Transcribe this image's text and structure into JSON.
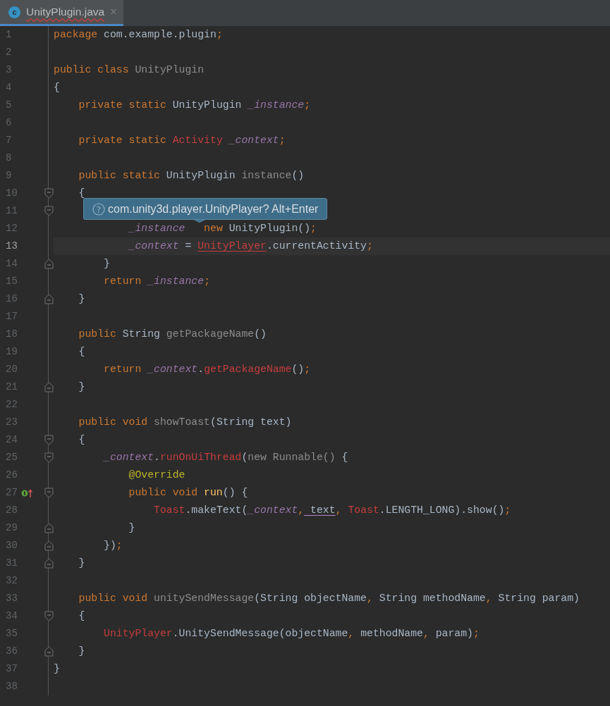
{
  "tab": {
    "icon_text": "c",
    "title": "UnityPlugin.java",
    "close": "×",
    "selected": true,
    "error": true
  },
  "tooltip": {
    "icon_text": "?",
    "text": "com.unity3d.player.UnityPlayer? Alt+Enter"
  },
  "lines": [
    {
      "number": "1",
      "current": false,
      "tokens": [
        {
          "text": "package",
          "kind": "kw"
        },
        {
          "text": " com.example.plugin",
          "kind": "plain"
        },
        {
          "text": ";",
          "kind": "kw"
        }
      ]
    },
    {
      "number": "2",
      "current": false
    },
    {
      "number": "3",
      "current": false,
      "tokens": [
        {
          "text": "public class",
          "kind": "kw"
        },
        {
          "text": " UnityPlugin",
          "kind": "unused"
        }
      ]
    },
    {
      "number": "4",
      "current": false,
      "tokens": [
        {
          "text": "{",
          "kind": "plain"
        }
      ]
    },
    {
      "number": "5",
      "current": false,
      "tokens": [
        {
          "text": "    private static",
          "kind": "kw"
        },
        {
          "text": " UnityPlugin ",
          "kind": "plain"
        },
        {
          "text": "_instance",
          "kind": "field"
        },
        {
          "text": ";",
          "kind": "kw"
        }
      ]
    },
    {
      "number": "6",
      "current": false
    },
    {
      "number": "7",
      "current": false,
      "tokens": [
        {
          "text": "    private static",
          "kind": "kw"
        },
        {
          "text": " Activity",
          "kind": "error"
        },
        {
          "text": " _context",
          "kind": "field"
        },
        {
          "text": ";",
          "kind": "kw"
        }
      ]
    },
    {
      "number": "8",
      "current": false
    },
    {
      "number": "9",
      "current": false,
      "tokens": [
        {
          "text": "    public static",
          "kind": "kw"
        },
        {
          "text": " UnityPlugin ",
          "kind": "plain"
        },
        {
          "text": "instance",
          "kind": "unused"
        },
        {
          "text": "()",
          "kind": "plain"
        }
      ]
    },
    {
      "number": "10",
      "current": false,
      "fold_start": true,
      "tokens": [
        {
          "text": "    {",
          "kind": "plain"
        }
      ]
    },
    {
      "number": "11",
      "current": false,
      "fold_start": true
    },
    {
      "number": "12",
      "current": false,
      "tokens": [
        {
          "text": "            _instance",
          "kind": "field"
        },
        {
          "text": "   new",
          "kind": "kw"
        },
        {
          "text": " UnityPlugin()",
          "kind": "plain"
        },
        {
          "text": ";",
          "kind": "kw"
        }
      ]
    },
    {
      "number": "13",
      "current": true,
      "tokens": [
        {
          "text": "            _context",
          "kind": "field"
        },
        {
          "text": " = ",
          "kind": "plain"
        },
        {
          "text": "UnityPlayer",
          "kind": "unresolved"
        },
        {
          "text": ".currentActivity",
          "kind": "plain"
        },
        {
          "text": ";",
          "kind": "kw"
        }
      ]
    },
    {
      "number": "14",
      "current": false,
      "fold_end": true,
      "tokens": [
        {
          "text": "        }",
          "kind": "plain"
        }
      ]
    },
    {
      "number": "15",
      "current": false,
      "tokens": [
        {
          "text": "        return",
          "kind": "kw"
        },
        {
          "text": " _instance",
          "kind": "field"
        },
        {
          "text": ";",
          "kind": "kw"
        }
      ]
    },
    {
      "number": "16",
      "current": false,
      "fold_end": true,
      "tokens": [
        {
          "text": "    }",
          "kind": "plain"
        }
      ]
    },
    {
      "number": "17",
      "current": false
    },
    {
      "number": "18",
      "current": false,
      "tokens": [
        {
          "text": "    public",
          "kind": "kw"
        },
        {
          "text": " String ",
          "kind": "plain"
        },
        {
          "text": "getPackageName",
          "kind": "unused"
        },
        {
          "text": "()",
          "kind": "plain"
        }
      ]
    },
    {
      "number": "19",
      "current": false,
      "tokens": [
        {
          "text": "    {",
          "kind": "plain"
        }
      ]
    },
    {
      "number": "20",
      "current": false,
      "tokens": [
        {
          "text": "        return",
          "kind": "kw"
        },
        {
          "text": " _context",
          "kind": "field"
        },
        {
          "text": ".",
          "kind": "plain"
        },
        {
          "text": "getPackageName",
          "kind": "error"
        },
        {
          "text": "()",
          "kind": "plain"
        },
        {
          "text": ";",
          "kind": "kw"
        }
      ]
    },
    {
      "number": "21",
      "current": false,
      "fold_end": true,
      "tokens": [
        {
          "text": "    }",
          "kind": "plain"
        }
      ]
    },
    {
      "number": "22",
      "current": false
    },
    {
      "number": "23",
      "current": false,
      "tokens": [
        {
          "text": "    public void",
          "kind": "kw"
        },
        {
          "text": " showToast",
          "kind": "unused"
        },
        {
          "text": "(String text)",
          "kind": "plain"
        }
      ]
    },
    {
      "number": "24",
      "current": false,
      "fold_start": true,
      "tokens": [
        {
          "text": "    {",
          "kind": "plain"
        }
      ]
    },
    {
      "number": "25",
      "current": false,
      "fold_start": true,
      "tokens": [
        {
          "text": "        _context",
          "kind": "field"
        },
        {
          "text": ".",
          "kind": "plain"
        },
        {
          "text": "runOnUiThread",
          "kind": "error"
        },
        {
          "text": "(",
          "kind": "plain"
        },
        {
          "text": "new Runnable()",
          "kind": "unused"
        },
        {
          "text": " {",
          "kind": "plain"
        }
      ]
    },
    {
      "number": "26",
      "current": false,
      "tokens": [
        {
          "text": "            @Override",
          "kind": "annotation"
        }
      ]
    },
    {
      "number": "27",
      "current": false,
      "fold_start": true,
      "override": true,
      "tokens": [
        {
          "text": "            public void",
          "kind": "kw"
        },
        {
          "text": " run",
          "kind": "method"
        },
        {
          "text": "() {",
          "kind": "plain"
        }
      ]
    },
    {
      "number": "28",
      "current": false,
      "tokens": [
        {
          "text": "                Toast",
          "kind": "error"
        },
        {
          "text": ".makeText(",
          "kind": "plain"
        },
        {
          "text": "_context",
          "kind": "field"
        },
        {
          "text": ",",
          "kind": "kw"
        },
        {
          "text": " text",
          "kind": "captured"
        },
        {
          "text": ",",
          "kind": "kw"
        },
        {
          "text": " Toast",
          "kind": "error"
        },
        {
          "text": ".LENGTH_LONG).show()",
          "kind": "plain"
        },
        {
          "text": ";",
          "kind": "kw"
        }
      ]
    },
    {
      "number": "29",
      "current": false,
      "fold_end": true,
      "tokens": [
        {
          "text": "            }",
          "kind": "plain"
        }
      ]
    },
    {
      "number": "30",
      "current": false,
      "fold_end": true,
      "tokens": [
        {
          "text": "        })",
          "kind": "plain"
        },
        {
          "text": ";",
          "kind": "kw"
        }
      ]
    },
    {
      "number": "31",
      "current": false,
      "fold_end": true,
      "tokens": [
        {
          "text": "    }",
          "kind": "plain"
        }
      ]
    },
    {
      "number": "32",
      "current": false
    },
    {
      "number": "33",
      "current": false,
      "tokens": [
        {
          "text": "    public void",
          "kind": "kw"
        },
        {
          "text": " unitySendMessage",
          "kind": "unused"
        },
        {
          "text": "(String objectName",
          "kind": "plain"
        },
        {
          "text": ",",
          "kind": "kw"
        },
        {
          "text": " String methodName",
          "kind": "plain"
        },
        {
          "text": ",",
          "kind": "kw"
        },
        {
          "text": " String param)",
          "kind": "plain"
        }
      ]
    },
    {
      "number": "34",
      "current": false,
      "fold_start": true,
      "tokens": [
        {
          "text": "    {",
          "kind": "plain"
        }
      ]
    },
    {
      "number": "35",
      "current": false,
      "tokens": [
        {
          "text": "        UnityPlayer",
          "kind": "error"
        },
        {
          "text": ".UnitySendMessage(objectName",
          "kind": "plain"
        },
        {
          "text": ",",
          "kind": "kw"
        },
        {
          "text": " methodName",
          "kind": "plain"
        },
        {
          "text": ",",
          "kind": "kw"
        },
        {
          "text": " param)",
          "kind": "plain"
        },
        {
          "text": ";",
          "kind": "kw"
        }
      ]
    },
    {
      "number": "36",
      "current": false,
      "fold_end": true,
      "tokens": [
        {
          "text": "    }",
          "kind": "plain"
        }
      ]
    },
    {
      "number": "37",
      "current": false,
      "tokens": [
        {
          "text": "}",
          "kind": "plain"
        }
      ]
    },
    {
      "number": "38",
      "current": false
    }
  ]
}
